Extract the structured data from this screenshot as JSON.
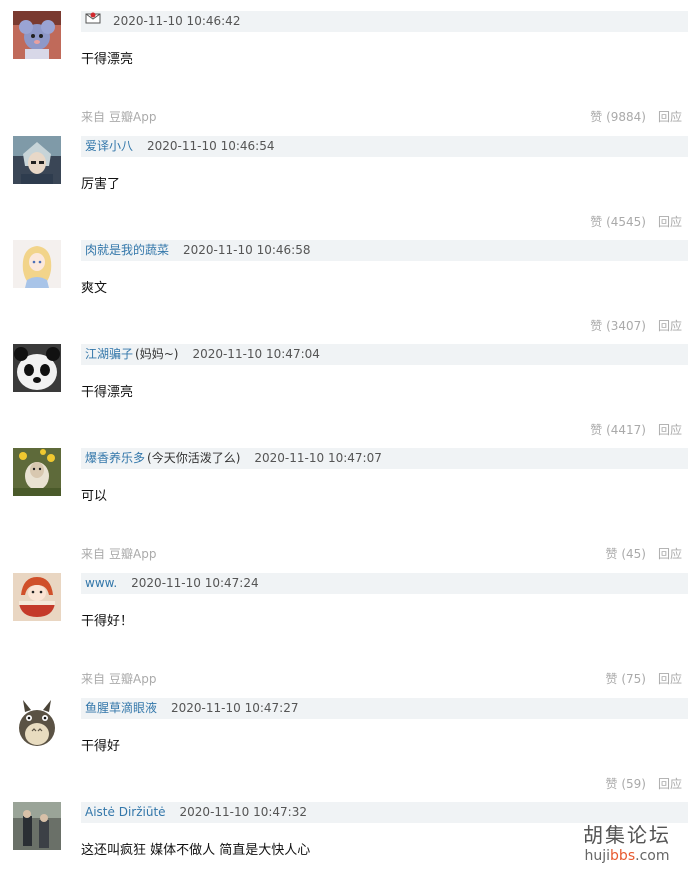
{
  "comments": [
    {
      "name": "",
      "sig": "",
      "time": "2020-11-10 10:46:42",
      "content": "干得漂亮",
      "source_prefix": "来自",
      "source_app": "豆瓣App",
      "likes": "赞 (9884)",
      "reply": "回应",
      "avatar_icon": "avatar-mouse-icon"
    },
    {
      "name": "爱译小八",
      "sig": "",
      "time": "2020-11-10 10:46:54",
      "content": "厉害了",
      "source_prefix": "",
      "source_app": "",
      "likes": "赞 (4545)",
      "reply": "回应",
      "avatar_icon": "avatar-anime-boy-icon"
    },
    {
      "name": "肉就是我的蔬菜",
      "sig": "",
      "time": "2020-11-10 10:46:58",
      "content": "爽文",
      "source_prefix": "",
      "source_app": "",
      "likes": "赞 (3407)",
      "reply": "回应",
      "avatar_icon": "avatar-blonde-girl-icon"
    },
    {
      "name": "江湖骗子",
      "sig": "(妈妈~)",
      "time": "2020-11-10 10:47:04",
      "content": "干得漂亮",
      "source_prefix": "",
      "source_app": "",
      "likes": "赞 (4417)",
      "reply": "回应",
      "avatar_icon": "avatar-panda-icon"
    },
    {
      "name": "爆香养乐多",
      "sig": "(今天你活泼了么)",
      "time": "2020-11-10 10:47:07",
      "content": "可以",
      "source_prefix": "来自",
      "source_app": "豆瓣App",
      "likes": "赞 (45)",
      "reply": "回应",
      "avatar_icon": "avatar-lamb-icon"
    },
    {
      "name": "www.",
      "sig": "",
      "time": "2020-11-10 10:47:24",
      "content": "干得好！",
      "source_prefix": "来自",
      "source_app": "豆瓣App",
      "likes": "赞 (75)",
      "reply": "回应",
      "avatar_icon": "avatar-ramen-girl-icon"
    },
    {
      "name": "鱼腥草滴眼液",
      "sig": "",
      "time": "2020-11-10 10:47:27",
      "content": "干得好",
      "source_prefix": "",
      "source_app": "",
      "likes": "赞 (59)",
      "reply": "回应",
      "avatar_icon": "avatar-totoro-icon"
    },
    {
      "name": "Aistė Diržiūtė",
      "sig": "",
      "time": "2020-11-10 10:47:32",
      "content": "这还叫疯狂 媒体不做人 简直是大快人心",
      "avatar_icon": "avatar-people-photo-icon"
    }
  ],
  "watermark": {
    "cn": "胡集论坛",
    "en_a": "huji",
    "en_b": "bbs",
    "en_c": ".com"
  },
  "colors": {
    "name_link": "#3377aa",
    "header_bg": "#f0f3f5",
    "meta_gray": "#aaaaaa"
  }
}
